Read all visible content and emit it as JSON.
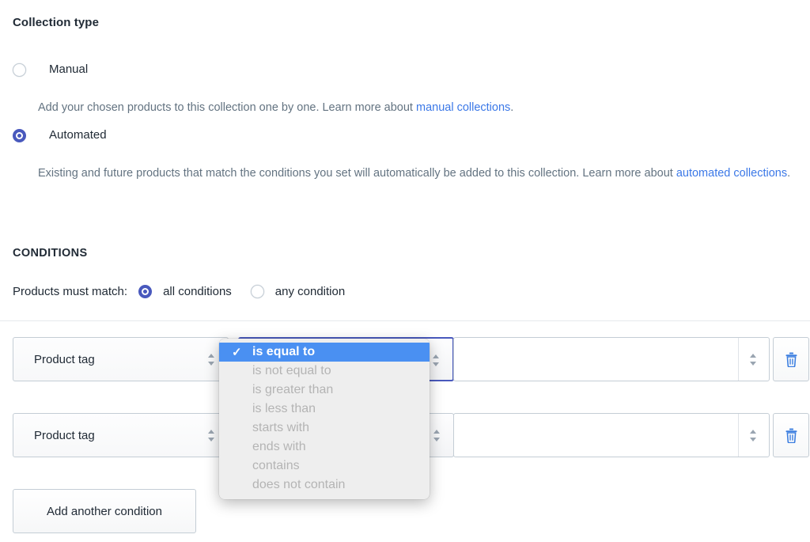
{
  "page": {
    "collection_type_heading": "Collection type",
    "conditions_heading": "CONDITIONS"
  },
  "collection_type": {
    "options": [
      {
        "label": "Manual",
        "selected": false,
        "description_before": "Add your chosen products to this collection one by one. Learn more about ",
        "link_text": "manual collections",
        "description_after": "."
      },
      {
        "label": "Automated",
        "selected": true,
        "description_before": "Existing and future products that match the conditions you set will automatically be added to this collection. Learn more about ",
        "link_text": "automated collections",
        "description_after": "."
      }
    ]
  },
  "conditions": {
    "match_label": "Products must match:",
    "match_options": [
      {
        "label": "all conditions",
        "selected": true
      },
      {
        "label": "any condition",
        "selected": false
      }
    ],
    "rows": [
      {
        "field": "Product tag",
        "operator": "",
        "value": ""
      },
      {
        "field": "Product tag",
        "operator": "",
        "value": ""
      }
    ],
    "add_button_label": "Add another condition",
    "delete_icon": "trash-icon",
    "stepper_icon": "updown-chevron-icon"
  },
  "operator_dropdown": {
    "open_on_row": 1,
    "selected": "is equal to",
    "check_glyph": "✓",
    "options": [
      "is equal to",
      "is not equal to",
      "is greater than",
      "is less than",
      "starts with",
      "ends with",
      "contains",
      "does not contain"
    ]
  },
  "colors": {
    "accent_radio": "#4959bd",
    "link": "#3b78e7",
    "dropdown_highlight": "#4a90f2",
    "trash_icon": "#3d7fe0",
    "text": "#212b36",
    "muted_text": "#637381",
    "border": "#c4cdd5"
  }
}
